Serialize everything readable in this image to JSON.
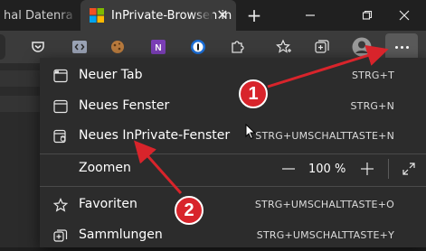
{
  "tabs": [
    {
      "title": "hal Datenra",
      "active": false
    },
    {
      "title": "InPrivate-Browsen in",
      "active": true
    }
  ],
  "menu": {
    "items": [
      {
        "label": "Neuer Tab",
        "shortcut": "STRG+T",
        "icon": "new-tab-icon"
      },
      {
        "label": "Neues Fenster",
        "shortcut": "STRG+N",
        "icon": "new-window-icon"
      },
      {
        "label": "Neues InPrivate-Fenster",
        "shortcut": "STRG+UMSCHALTTASTE+N",
        "icon": "inprivate-window-icon"
      },
      {
        "label": "Favoriten",
        "shortcut": "STRG+UMSCHALTTASTE+O",
        "icon": "favorites-star-icon"
      },
      {
        "label": "Sammlungen",
        "shortcut": "STRG+UMSCHALTTASTE+Y",
        "icon": "collections-icon"
      }
    ],
    "zoom": {
      "label": "Zoomen",
      "value": "100 %"
    }
  },
  "annotations": [
    "1",
    "2"
  ],
  "colors": {
    "accent_red": "#d8242b",
    "menu_bg": "#2c2c2c",
    "toolbar_bg": "#3b3b3b"
  }
}
